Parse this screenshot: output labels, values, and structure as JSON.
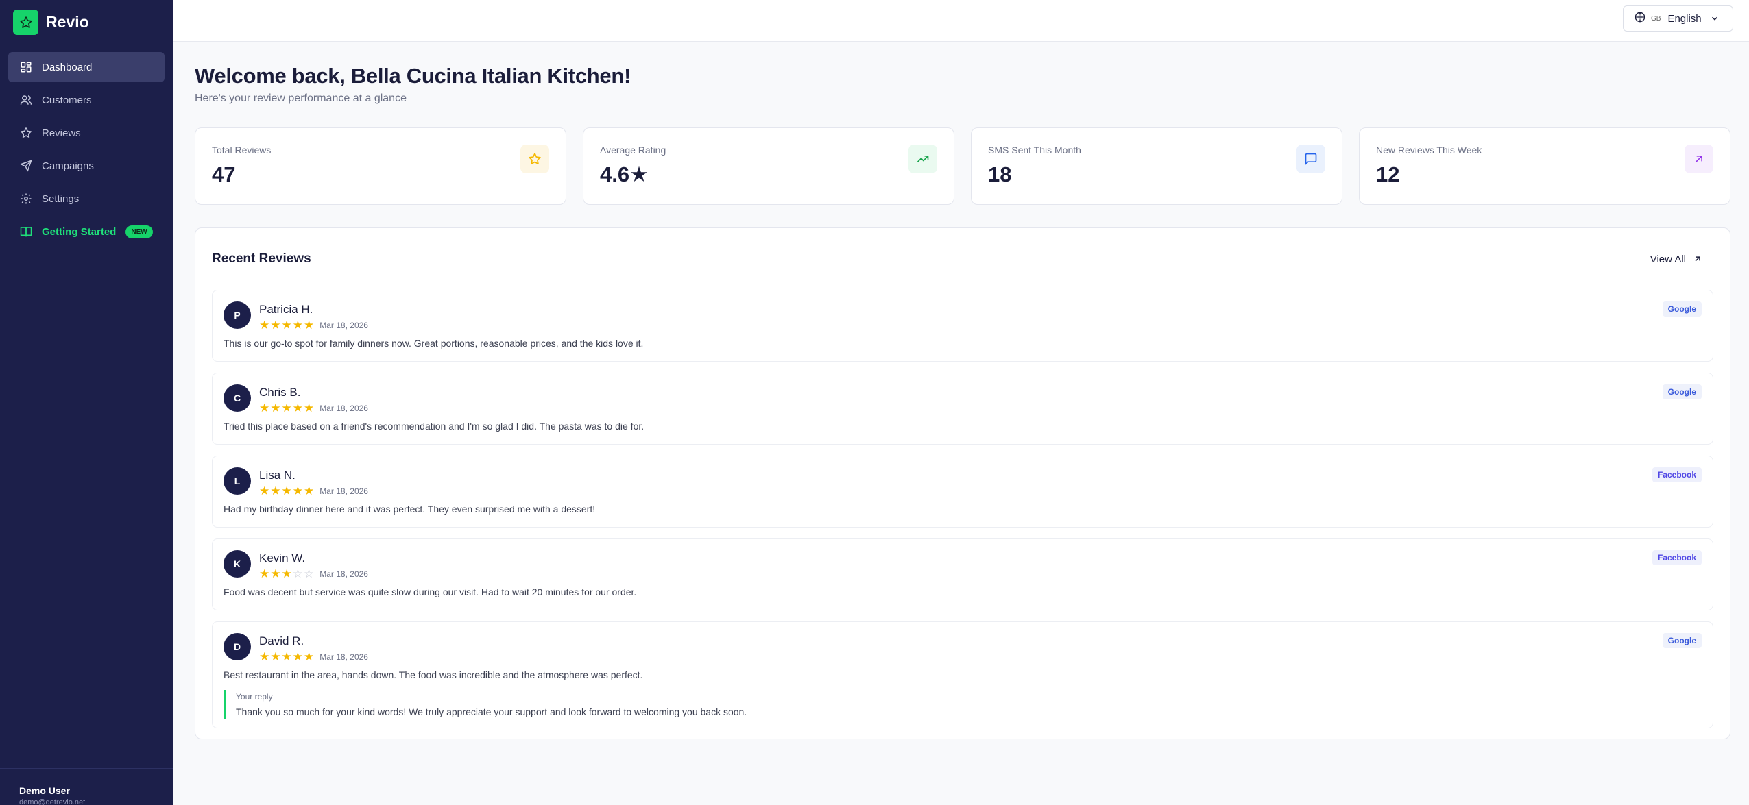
{
  "app": {
    "name": "Revio"
  },
  "sidebar": {
    "items": [
      {
        "label": "Dashboard",
        "icon": "grid-icon",
        "active": true
      },
      {
        "label": "Customers",
        "icon": "users-icon"
      },
      {
        "label": "Reviews",
        "icon": "star-icon"
      },
      {
        "label": "Campaigns",
        "icon": "send-icon"
      },
      {
        "label": "Settings",
        "icon": "gear-icon"
      }
    ],
    "getting_started": {
      "label": "Getting Started",
      "badge": "NEW",
      "icon": "book-icon"
    },
    "user": {
      "name": "Demo User",
      "email": "demo@getrevio.net"
    }
  },
  "topbar": {
    "language": {
      "flag": "GB",
      "label": "English"
    }
  },
  "header": {
    "title": "Welcome back, Bella Cucina Italian Kitchen!",
    "subtitle": "Here's your review performance at a glance"
  },
  "stats": [
    {
      "label": "Total Reviews",
      "value": "47",
      "icon": "star-icon",
      "color": "#f5b800"
    },
    {
      "label": "Average Rating",
      "value": "4.6★",
      "icon": "trending-up-icon",
      "color": "#16a34a"
    },
    {
      "label": "SMS Sent This Month",
      "value": "18",
      "icon": "message-icon",
      "color": "#2563eb"
    },
    {
      "label": "New Reviews This Week",
      "value": "12",
      "icon": "arrow-up-right-icon",
      "color": "#9333ea"
    }
  ],
  "recent_reviews": {
    "title": "Recent Reviews",
    "view_all": "View All",
    "items": [
      {
        "initial": "P",
        "name": "Patricia H.",
        "rating": 5,
        "date": "Mar 18, 2026",
        "platform": "Google",
        "text": "This is our go-to spot for family dinners now. Great portions, reasonable prices, and the kids love it."
      },
      {
        "initial": "C",
        "name": "Chris B.",
        "rating": 5,
        "date": "Mar 18, 2026",
        "platform": "Google",
        "text": "Tried this place based on a friend's recommendation and I'm so glad I did. The pasta was to die for."
      },
      {
        "initial": "L",
        "name": "Lisa N.",
        "rating": 5,
        "date": "Mar 18, 2026",
        "platform": "Facebook",
        "text": "Had my birthday dinner here and it was perfect. They even surprised me with a dessert!"
      },
      {
        "initial": "K",
        "name": "Kevin W.",
        "rating": 3,
        "date": "Mar 18, 2026",
        "platform": "Facebook",
        "text": "Food was decent but service was quite slow during our visit. Had to wait 20 minutes for our order."
      },
      {
        "initial": "D",
        "name": "David R.",
        "rating": 5,
        "date": "Mar 18, 2026",
        "platform": "Google",
        "text": "Best restaurant in the area, hands down. The food was incredible and the atmosphere was perfect.",
        "reply": {
          "label": "Your reply",
          "text": "Thank you so much for your kind words! We truly appreciate your support and look forward to welcoming you back soon."
        }
      }
    ]
  }
}
